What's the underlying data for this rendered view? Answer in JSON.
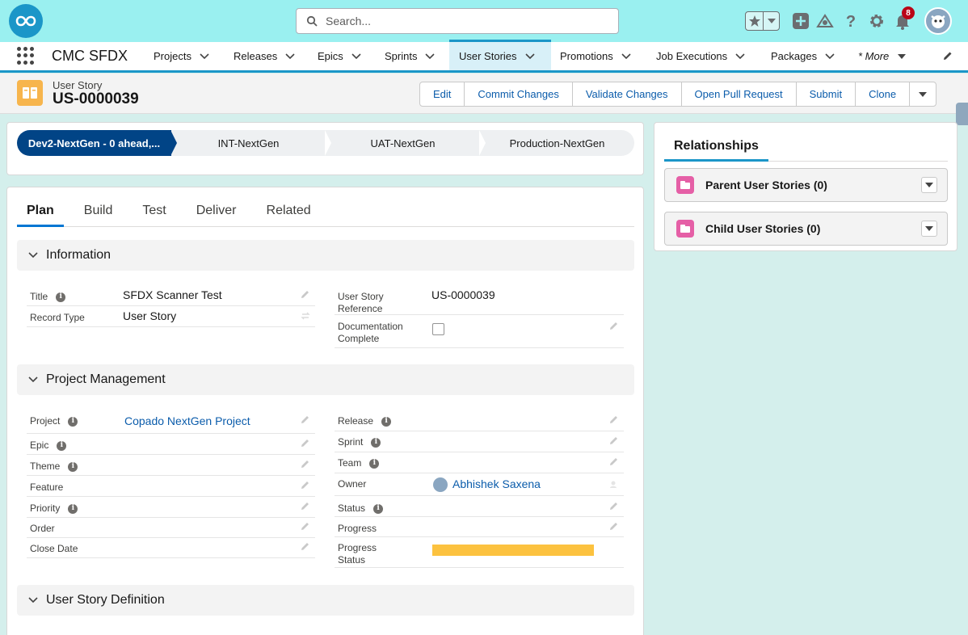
{
  "header": {
    "search_placeholder": "Search...",
    "notification_count": "8"
  },
  "nav": {
    "app_name": "CMC SFDX",
    "items": [
      "Projects",
      "Releases",
      "Epics",
      "Sprints",
      "User Stories",
      "Promotions",
      "Job Executions",
      "Packages"
    ],
    "active": "User Stories",
    "more": "* More"
  },
  "record": {
    "type": "User Story",
    "name": "US-0000039",
    "actions": [
      "Edit",
      "Commit Changes",
      "Validate Changes",
      "Open Pull Request",
      "Submit",
      "Clone"
    ]
  },
  "path": {
    "steps": [
      "Dev2-NextGen - 0 ahead,...",
      "INT-NextGen",
      "UAT-NextGen",
      "Production-NextGen"
    ],
    "current_index": 0
  },
  "tabs": [
    "Plan",
    "Build",
    "Test",
    "Deliver",
    "Related"
  ],
  "active_tab": "Plan",
  "sections": {
    "information": "Information",
    "project_management": "Project Management",
    "definition": "User Story Definition"
  },
  "information": {
    "title_label": "Title",
    "title_value": "SFDX Scanner Test",
    "record_type_label": "Record Type",
    "record_type_value": "User Story",
    "reference_label": "User Story Reference",
    "reference_value": "US-0000039",
    "doc_complete_label": "Documentation Complete",
    "doc_complete_value": false
  },
  "project_management": {
    "project_label": "Project",
    "project_value": "Copado NextGen Project",
    "epic_label": "Epic",
    "theme_label": "Theme",
    "feature_label": "Feature",
    "priority_label": "Priority",
    "order_label": "Order",
    "close_date_label": "Close Date",
    "release_label": "Release",
    "sprint_label": "Sprint",
    "team_label": "Team",
    "owner_label": "Owner",
    "owner_value": "Abhishek Saxena",
    "status_label": "Status",
    "progress_label": "Progress",
    "progress_status_label": "Progress Status",
    "progress_status_color": "#fcc23f"
  },
  "relationships": {
    "title": "Relationships",
    "items": [
      "Parent User Stories (0)",
      "Child User Stories (0)"
    ]
  },
  "colors": {
    "header_bg": "#9af0f0",
    "brand": "#1b96c8",
    "path_current": "#014486",
    "link": "#0b5cab"
  }
}
